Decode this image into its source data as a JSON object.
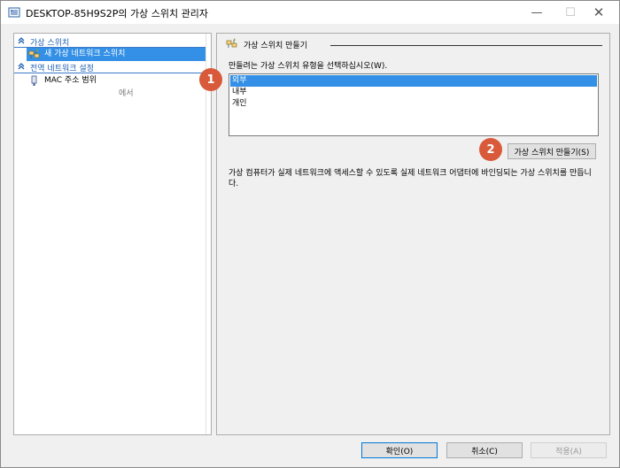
{
  "window": {
    "title": "DESKTOP-85H9S2P의 가상 스위치 관리자",
    "minimize_glyph": "—",
    "maximize_glyph": "☐",
    "close_glyph": "✕"
  },
  "sidebar": {
    "sections": [
      {
        "label": "가상 스위치",
        "icon": "chevron-up-icon"
      },
      {
        "label": "전역 네트워크 설정",
        "icon": "chevron-up-icon"
      }
    ],
    "items": [
      {
        "label": "새 가상 네트워크 스위치",
        "icon": "virtual-switch-icon",
        "selected": true
      },
      {
        "label": "MAC 주소 범위",
        "icon": "mac-address-icon",
        "selected": false
      }
    ],
    "mac_sub": "에서"
  },
  "main": {
    "group_title": "가상 스위치 만들기",
    "prompt": "만들려는 가상 스위치 유형을 선택하십시오(W).",
    "options": [
      {
        "label": "외부",
        "selected": true
      },
      {
        "label": "내부",
        "selected": false
      },
      {
        "label": "개인",
        "selected": false
      }
    ],
    "create_button": "가상 스위치 만들기(S)",
    "description": "가상 컴퓨터가 실제 네트워크에 액세스할 수 있도록 실제 네트워크 어댑터에 바인딩되는 가상 스위치를 만듭니다."
  },
  "badges": {
    "one": "1",
    "two": "2"
  },
  "buttons": {
    "ok": "확인(O)",
    "cancel": "취소(C)",
    "apply": "적용(A)"
  },
  "colors": {
    "selection": "#3390e6",
    "section_text": "#1e5fb4",
    "badge": "#d95a3a"
  }
}
